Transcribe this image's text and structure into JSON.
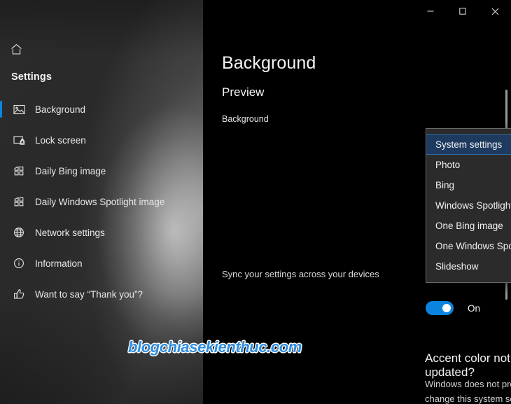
{
  "sidebar": {
    "home_icon": "home-icon",
    "title": "Settings",
    "items": [
      {
        "label": "Background",
        "icon": "image-icon",
        "active": true
      },
      {
        "label": "Lock screen",
        "icon": "lock-screen-icon",
        "active": false
      },
      {
        "label": "Daily Bing image",
        "icon": "windows-grid-icon",
        "active": false
      },
      {
        "label": "Daily Windows Spotlight image",
        "icon": "windows-grid-icon",
        "active": false
      },
      {
        "label": "Network settings",
        "icon": "globe-icon",
        "active": false
      },
      {
        "label": "Information",
        "icon": "info-circle-icon",
        "active": false
      },
      {
        "label": "Want to say “Thank you”?",
        "icon": "thumbs-up-icon",
        "active": false
      }
    ]
  },
  "window": {
    "controls": {
      "minimize": "–",
      "maximize": "□",
      "close": "✕"
    },
    "page_title": "Background",
    "section_title": "Preview",
    "field_label": "Background",
    "sync_text": "Sync your settings across your devices",
    "toggle": {
      "state_label": "On",
      "on": true,
      "accent_color": "#0a84e0"
    },
    "accent_heading": "Accent color not updated?",
    "accent_body": "Windows does not provide the ability for modern applications to change this system setting. You must access to the Windows"
  },
  "dropdown": {
    "open": true,
    "selected": "System settings",
    "highlight_color": "#1e3a5f",
    "options": [
      "System settings",
      "Photo",
      "Bing",
      "Windows Spotlight",
      "One Bing image",
      "One Windows Spotlight image",
      "Slideshow"
    ]
  },
  "watermark": {
    "text": "blogchiasekienthuc.com",
    "color": "#2f8de0"
  }
}
